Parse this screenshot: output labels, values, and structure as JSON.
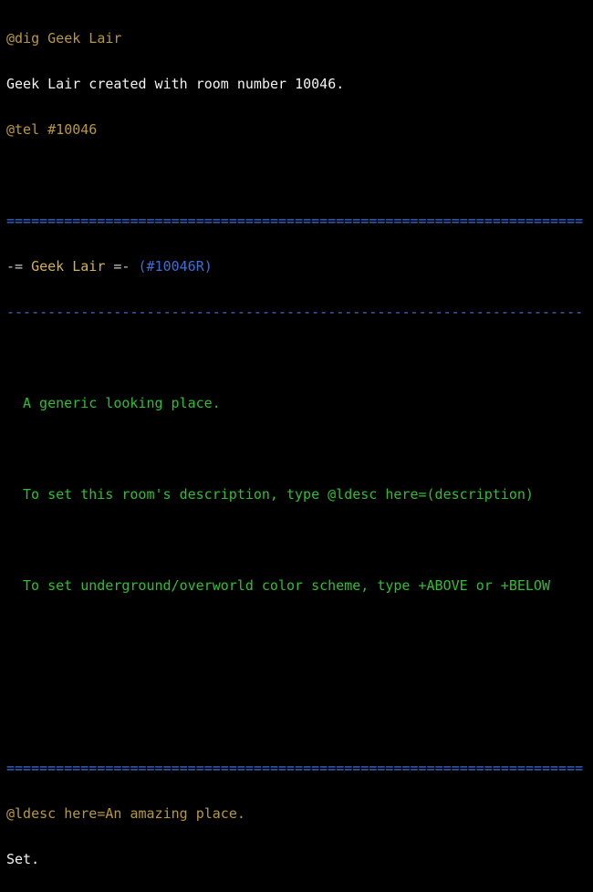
{
  "terminal": {
    "cmd_dig": "@dig Geek Lair",
    "dig_result": "Geek Lair created with room number 10046.",
    "cmd_tel": "@tel #10046",
    "separator_double": "======================================================================",
    "room_title_prefix": "-= ",
    "room_name": "Geek Lair",
    "room_title_suffix": " =- ",
    "room_id": "(#10046R)",
    "separator_single": "----------------------------------------------------------------------",
    "desc_line1": "A generic looking place.",
    "desc_line2": "To set this room's description, type @ldesc here=(description)",
    "desc_line3": "To set underground/overworld color scheme, type +ABOVE or +BELOW",
    "separator_double_bottom": "======================================================================",
    "cmd_ldesc": "@ldesc here=An amazing place.",
    "ldesc_result": "Set."
  },
  "colors": {
    "command": "#b8993a",
    "output": "#f2f2f2",
    "description": "#2fbf2f",
    "accent": "#3b6fd6"
  }
}
